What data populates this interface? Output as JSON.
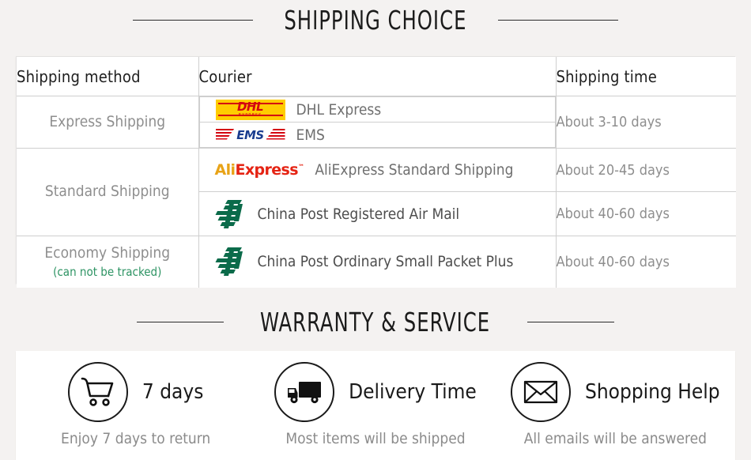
{
  "sections": {
    "shipping": {
      "title": "SHIPPING CHOICE"
    },
    "warranty": {
      "title": "WARRANTY & SERVICE"
    }
  },
  "shipping_table": {
    "headers": {
      "method": "Shipping method",
      "courier": "Courier",
      "time": "Shipping time"
    },
    "rows": [
      {
        "method": "Express Shipping",
        "method_note": "",
        "couriers": [
          {
            "logo": "dhl-logo",
            "name": "DHL Express"
          },
          {
            "logo": "ems-logo",
            "name": "EMS"
          }
        ],
        "time": "About 3-10 days"
      },
      {
        "method": "Standard Shipping",
        "method_note": "",
        "couriers": [
          {
            "logo": "aliexpress-logo",
            "name": "AliExpress Standard Shipping"
          },
          {
            "logo": "china-post-logo",
            "name": "China Post Registered Air Mail"
          }
        ],
        "times": [
          "About 20-45 days",
          "About 40-60 days"
        ]
      },
      {
        "method": "Economy Shipping",
        "method_note": "(can not be tracked)",
        "couriers": [
          {
            "logo": "china-post-logo",
            "name": "China Post Ordinary Small Packet Plus"
          }
        ],
        "time": "About 40-60 days"
      }
    ]
  },
  "services": [
    {
      "icon": "shopping-cart-icon",
      "title": "7 days",
      "desc": "Enjoy 7 days to return"
    },
    {
      "icon": "delivery-truck-icon",
      "title": "Delivery Time",
      "desc": "Most items will be shipped"
    },
    {
      "icon": "envelope-icon",
      "title": "Shopping Help",
      "desc": "All emails will be answered"
    }
  ],
  "colors": {
    "page_background": "#f4f2f1",
    "panel_background": "#ffffff",
    "border": "#cfcfcf",
    "heading_text": "#1b1b1b",
    "muted_text": "#8e8e8e",
    "green_note": "#2e9464",
    "dhl_yellow": "#FFCC00",
    "dhl_red": "#D40511",
    "ems_blue": "#1a3d8f",
    "ali_orange": "#E8A317",
    "ali_red": "#E52313",
    "china_post_green": "#0b6b4a"
  }
}
